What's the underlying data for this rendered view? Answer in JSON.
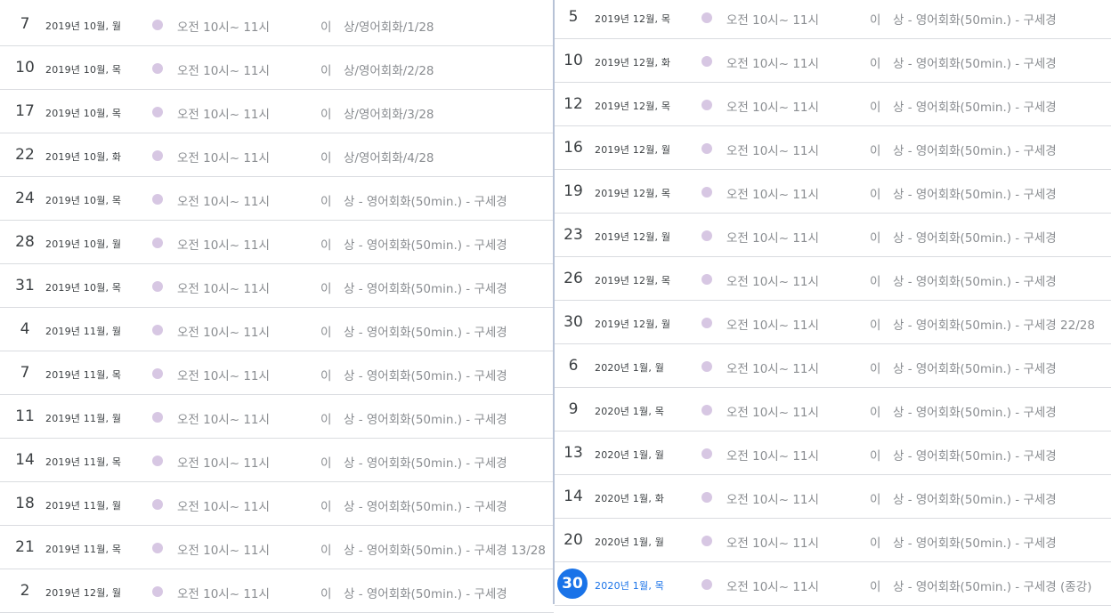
{
  "colors": {
    "dot": "#d7c7e3",
    "today_accent": "#1a73e8",
    "divider": "#b7c2d6"
  },
  "left_events": [
    {
      "day": "7",
      "date": "2019년 10월, 월",
      "time": "오전 10시~ 11시",
      "who": "이",
      "title": "상/영어회화/1/28"
    },
    {
      "day": "10",
      "date": "2019년 10월, 목",
      "time": "오전 10시~ 11시",
      "who": "이",
      "title": "상/영어회화/2/28"
    },
    {
      "day": "17",
      "date": "2019년 10월, 목",
      "time": "오전 10시~ 11시",
      "who": "이",
      "title": "상/영어회화/3/28"
    },
    {
      "day": "22",
      "date": "2019년 10월, 화",
      "time": "오전 10시~ 11시",
      "who": "이",
      "title": "상/영어회화/4/28"
    },
    {
      "day": "24",
      "date": "2019년 10월, 목",
      "time": "오전 10시~ 11시",
      "who": "이",
      "title": "상 - 영어회화(50min.) - 구세경"
    },
    {
      "day": "28",
      "date": "2019년 10월, 월",
      "time": "오전 10시~ 11시",
      "who": "이",
      "title": "상 - 영어회화(50min.) - 구세경"
    },
    {
      "day": "31",
      "date": "2019년 10월, 목",
      "time": "오전 10시~ 11시",
      "who": "이",
      "title": "상 - 영어회화(50min.) - 구세경"
    },
    {
      "day": "4",
      "date": "2019년 11월, 월",
      "time": "오전 10시~ 11시",
      "who": "이",
      "title": "상 - 영어회화(50min.) - 구세경"
    },
    {
      "day": "7",
      "date": "2019년 11월, 목",
      "time": "오전 10시~ 11시",
      "who": "이",
      "title": "상 - 영어회화(50min.) - 구세경"
    },
    {
      "day": "11",
      "date": "2019년 11월, 월",
      "time": "오전 10시~ 11시",
      "who": "이",
      "title": "상 - 영어회화(50min.) - 구세경"
    },
    {
      "day": "14",
      "date": "2019년 11월, 목",
      "time": "오전 10시~ 11시",
      "who": "이",
      "title": "상 - 영어회화(50min.) - 구세경"
    },
    {
      "day": "18",
      "date": "2019년 11월, 월",
      "time": "오전 10시~ 11시",
      "who": "이",
      "title": "상 - 영어회화(50min.) - 구세경"
    },
    {
      "day": "21",
      "date": "2019년 11월, 목",
      "time": "오전 10시~ 11시",
      "who": "이",
      "title": "상 - 영어회화(50min.) - 구세경 13/28"
    },
    {
      "day": "2",
      "date": "2019년 12월, 월",
      "time": "오전 10시~ 11시",
      "who": "이",
      "title": "상 - 영어회화(50min.) - 구세경"
    }
  ],
  "right_events": [
    {
      "day": "5",
      "date": "2019년 12월, 목",
      "time": "오전 10시~ 11시",
      "who": "이",
      "title": "상 - 영어회화(50min.) - 구세경"
    },
    {
      "day": "10",
      "date": "2019년 12월, 화",
      "time": "오전 10시~ 11시",
      "who": "이",
      "title": "상 - 영어회화(50min.) - 구세경"
    },
    {
      "day": "12",
      "date": "2019년 12월, 목",
      "time": "오전 10시~ 11시",
      "who": "이",
      "title": "상 - 영어회화(50min.) - 구세경"
    },
    {
      "day": "16",
      "date": "2019년 12월, 월",
      "time": "오전 10시~ 11시",
      "who": "이",
      "title": "상 - 영어회화(50min.) - 구세경"
    },
    {
      "day": "19",
      "date": "2019년 12월, 목",
      "time": "오전 10시~ 11시",
      "who": "이",
      "title": "상 - 영어회화(50min.) - 구세경"
    },
    {
      "day": "23",
      "date": "2019년 12월, 월",
      "time": "오전 10시~ 11시",
      "who": "이",
      "title": "상 - 영어회화(50min.) - 구세경"
    },
    {
      "day": "26",
      "date": "2019년 12월, 목",
      "time": "오전 10시~ 11시",
      "who": "이",
      "title": "상 - 영어회화(50min.) - 구세경"
    },
    {
      "day": "30",
      "date": "2019년 12월, 월",
      "time": "오전 10시~ 11시",
      "who": "이",
      "title": "상 - 영어회화(50min.) - 구세경 22/28"
    },
    {
      "day": "6",
      "date": "2020년 1월, 월",
      "time": "오전 10시~ 11시",
      "who": "이",
      "title": "상 - 영어회화(50min.) - 구세경"
    },
    {
      "day": "9",
      "date": "2020년 1월, 목",
      "time": "오전 10시~ 11시",
      "who": "이",
      "title": "상 - 영어회화(50min.) - 구세경"
    },
    {
      "day": "13",
      "date": "2020년 1월, 월",
      "time": "오전 10시~ 11시",
      "who": "이",
      "title": "상 - 영어회화(50min.) - 구세경"
    },
    {
      "day": "14",
      "date": "2020년 1월, 화",
      "time": "오전 10시~ 11시",
      "who": "이",
      "title": "상 - 영어회화(50min.) - 구세경"
    },
    {
      "day": "20",
      "date": "2020년 1월, 월",
      "time": "오전 10시~ 11시",
      "who": "이",
      "title": "상 - 영어회화(50min.) - 구세경"
    },
    {
      "day": "30",
      "date": "2020년 1월, 목",
      "time": "오전 10시~ 11시",
      "who": "이",
      "title": "상 - 영어회화(50min.) - 구세경 (종강)",
      "today": true
    }
  ]
}
